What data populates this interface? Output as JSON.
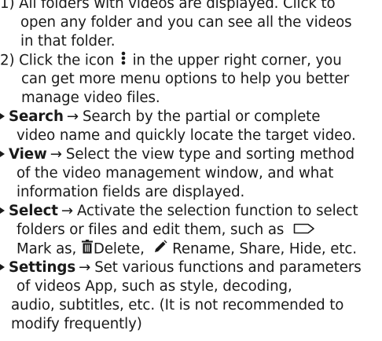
{
  "item1": {
    "line1": "1) All folders with videos are displayed. Click to",
    "line2": "open any folder and you can see all the videos",
    "line3": "in that folder."
  },
  "item2": {
    "line1_before_icon": "2) Click the icon",
    "line1_after_icon": "in the upper right corner, you",
    "line2": "can get more menu options to help you better",
    "line3": "manage video files.",
    "icon": "more-vertical-icon"
  },
  "search": {
    "label": "Search",
    "arrow": "→",
    "line1": "Search by the partial or complete",
    "line2": "video name and quickly locate the target video."
  },
  "view": {
    "label": "View",
    "arrow": "→",
    "line1": "Select the view type and sorting method",
    "line2": "of the video management window, and what",
    "line3": "information fields are displayed."
  },
  "select": {
    "label": "Select",
    "arrow": "→",
    "line1": "Activate the selection function to select",
    "line2": "folders or files and edit them, such as",
    "mark_as": "Mark as,",
    "delete": "Delete,",
    "rename": "Rename, Share, Hide, etc.",
    "icons": [
      "label-tag-icon",
      "trash-icon",
      "pencil-icon"
    ]
  },
  "settings": {
    "label": "Settings",
    "arrow": "→",
    "line1": "Set various functions and parameters",
    "line2": "of videos App, such as style, decoding,",
    "line3": "audio, subtitles, etc. (It is not recommended to",
    "line4": "modify frequently)"
  },
  "colors": {
    "text": "#1a1a1a",
    "background": "#ffffff"
  }
}
